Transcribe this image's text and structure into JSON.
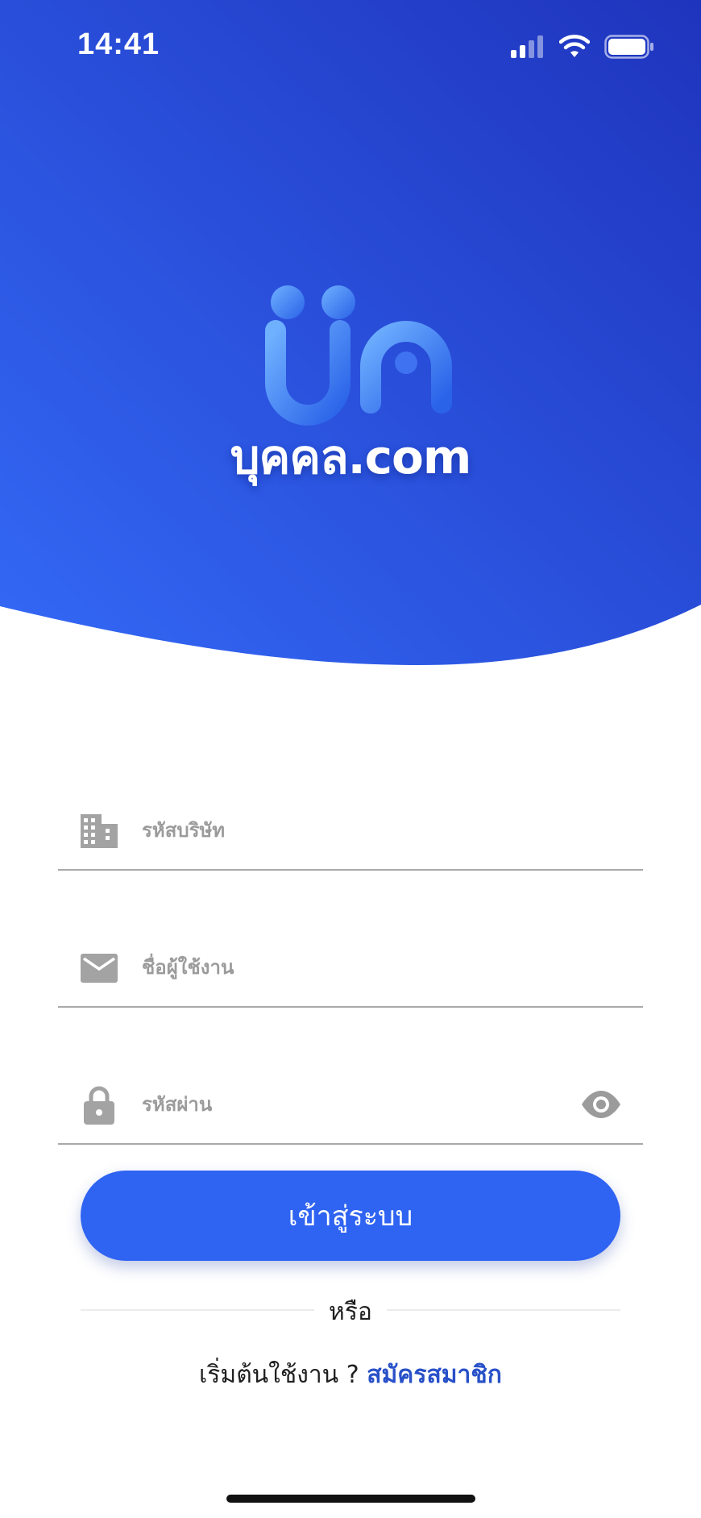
{
  "status_bar": {
    "time": "14:41",
    "icons": [
      "cellular-signal-icon",
      "wifi-icon",
      "battery-icon"
    ]
  },
  "brand": {
    "logo_icon": "bukhon-logo-icon",
    "name": "บุคคล.com"
  },
  "colors": {
    "hero_gradient_start": "#2f64f3",
    "hero_gradient_end": "#2038c0",
    "primary_button": "#2f63f2",
    "link": "#2850c8",
    "placeholder": "#9b9b9b",
    "field_underline": "#a9a9a9"
  },
  "form": {
    "company_code": {
      "placeholder": "รหัสบริษัท",
      "value": "",
      "icon": "building-icon"
    },
    "username": {
      "placeholder": "ชื่อผู้ใช้งาน",
      "value": "",
      "icon": "mail-icon"
    },
    "password": {
      "placeholder": "รหัสผ่าน",
      "value": "",
      "icon": "lock-icon",
      "toggle_icon": "eye-icon"
    },
    "login_label": "เข้าสู่ระบบ"
  },
  "divider": {
    "text": "หรือ"
  },
  "signup": {
    "prompt": "เริ่มต้นใช้งาน ?",
    "link_label": "สมัครสมาชิก"
  }
}
